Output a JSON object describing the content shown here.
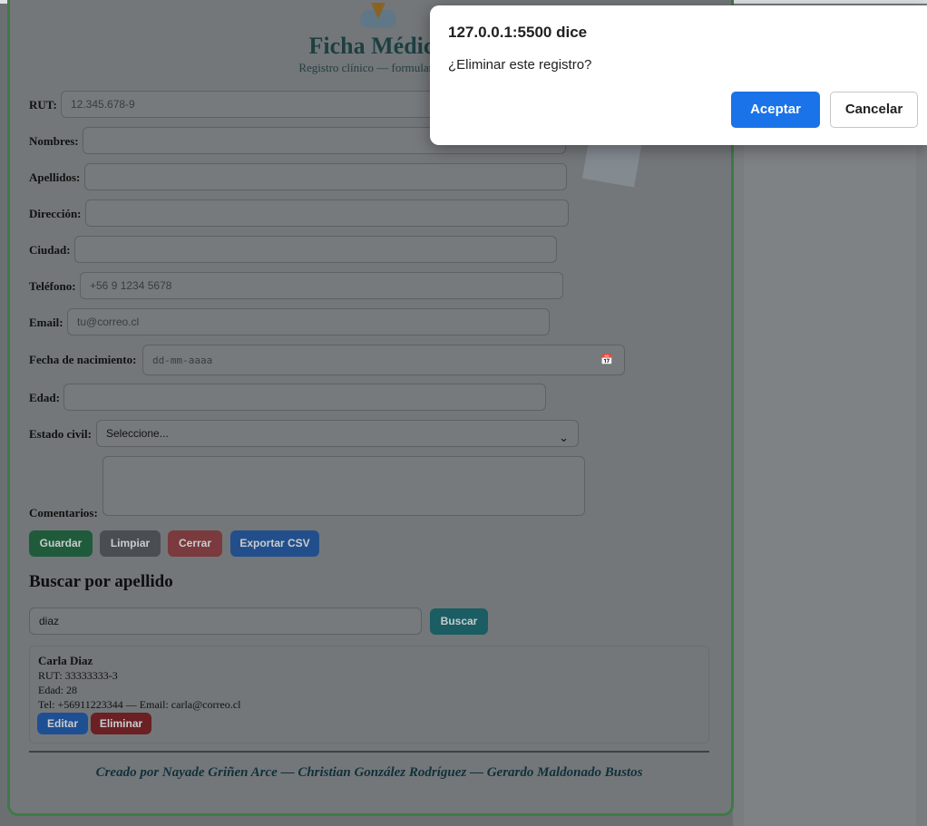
{
  "form": {
    "title": "Ficha Médica",
    "subtitle": "Registro clínico — formulario de",
    "fields": {
      "rut": {
        "label": "RUT:",
        "placeholder": "12.345.678-9"
      },
      "nombres": {
        "label": "Nombres:",
        "placeholder": ""
      },
      "apellidos": {
        "label": "Apellidos:",
        "placeholder": ""
      },
      "direccion": {
        "label": "Dirección:",
        "placeholder": ""
      },
      "ciudad": {
        "label": "Ciudad:",
        "placeholder": ""
      },
      "telefono": {
        "label": "Teléfono:",
        "placeholder": "+56 9 1234 5678"
      },
      "email": {
        "label": "Email:",
        "placeholder": "tu@correo.cl"
      },
      "fecha": {
        "label": "Fecha de nacimiento:",
        "placeholder": "dd-mm-aaaa"
      },
      "edad": {
        "label": "Edad:",
        "placeholder": ""
      },
      "estado_civil": {
        "label": "Estado civil:",
        "selected": "Seleccione..."
      },
      "comentarios": {
        "label": "Comentarios:",
        "placeholder": ""
      }
    },
    "buttons": {
      "guardar": "Guardar",
      "limpiar": "Limpiar",
      "cerrar": "Cerrar",
      "exportar": "Exportar CSV"
    }
  },
  "search": {
    "title": "Buscar por apellido",
    "value": "diaz",
    "button": "Buscar",
    "results": [
      {
        "name": "Carla Diaz",
        "rut": "RUT: 33333333-3",
        "edad": "Edad: 28",
        "contact": "Tel: +56911223344 — Email: carla@correo.cl",
        "edit": "Editar",
        "delete": "Eliminar"
      }
    ]
  },
  "footer": {
    "credits": "Creado por Nayade Griñen Arce — Christian González Rodríguez — Gerardo Maldonado Bustos"
  },
  "dialog": {
    "title": "127.0.0.1:5500 dice",
    "message": "¿Eliminar este registro?",
    "ok": "Aceptar",
    "cancel": "Cancelar"
  },
  "colors": {
    "dialog_primary": "#1a73e8",
    "card_border": "#3f7a46",
    "overlay": "#6b6f72"
  }
}
